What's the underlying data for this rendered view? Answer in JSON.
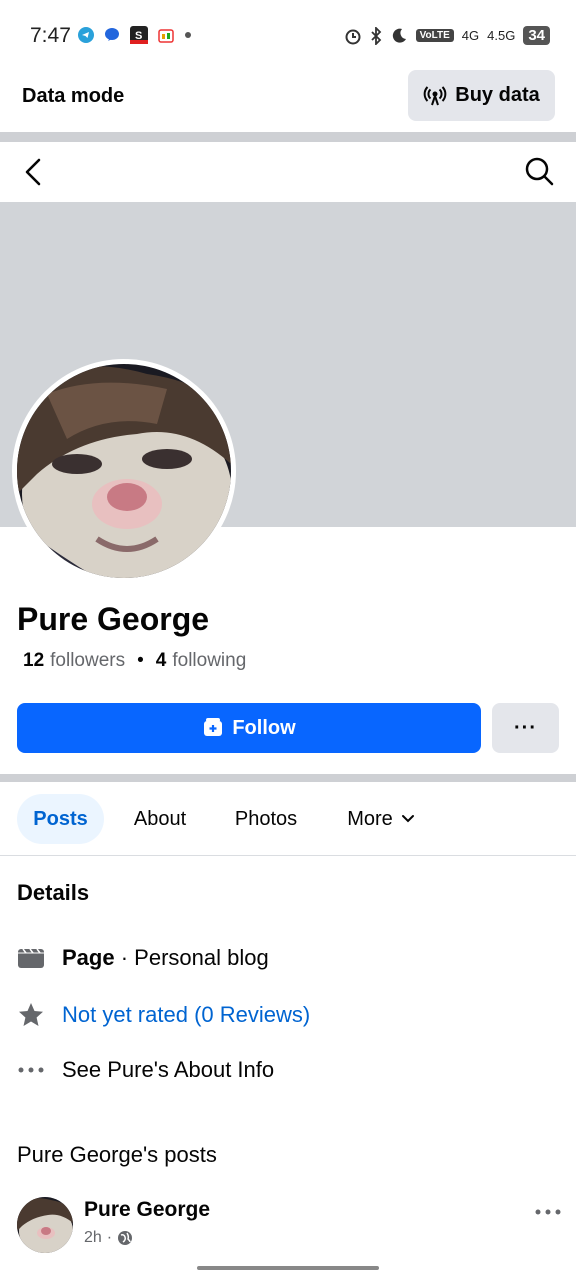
{
  "status_bar": {
    "time": "7:47",
    "network_1": "4G",
    "network_2": "4.5G",
    "volte": "VoLTE",
    "battery": "34"
  },
  "data_bar": {
    "label": "Data mode",
    "buy_label": "Buy data"
  },
  "profile": {
    "name": "Pure George",
    "followers_count": "12",
    "followers_label": "followers",
    "following_count": "4",
    "following_label": "following",
    "separator": "•"
  },
  "actions": {
    "follow_label": "Follow",
    "more_label": "···"
  },
  "tabs": [
    {
      "label": "Posts",
      "active": true
    },
    {
      "label": "About"
    },
    {
      "label": "Photos"
    },
    {
      "label": "More"
    }
  ],
  "details": {
    "heading": "Details",
    "page_label": "Page",
    "page_sep": " · ",
    "page_category": "Personal blog",
    "rating": "Not yet rated (0 Reviews)",
    "about_link": "See Pure's About Info"
  },
  "posts": {
    "heading": "Pure George's posts",
    "author": "Pure George",
    "time": "2h",
    "meta_sep": "·"
  },
  "colors": {
    "accent": "#0866ff",
    "link": "#0064d1",
    "cover": "#d1d4d8"
  }
}
